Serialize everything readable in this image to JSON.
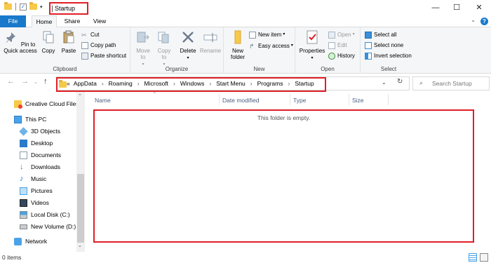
{
  "titlebar": {
    "title": "Startup",
    "minimize": "—",
    "maximize": "☐",
    "close": "✕"
  },
  "tabs": [
    {
      "label": "File"
    },
    {
      "label": "Home"
    },
    {
      "label": "Share"
    },
    {
      "label": "View"
    }
  ],
  "ribbon": {
    "clipboard": {
      "label": "Clipboard",
      "pin": "Pin to Quick access",
      "copy": "Copy",
      "paste": "Paste",
      "cut": "Cut",
      "copy_path": "Copy path",
      "paste_shortcut": "Paste shortcut"
    },
    "organize": {
      "label": "Organize",
      "move_to": "Move to",
      "copy_to": "Copy to",
      "delete": "Delete",
      "rename": "Rename"
    },
    "new": {
      "label": "New",
      "new_folder": "New folder",
      "new_item": "New item",
      "easy_access": "Easy access"
    },
    "open": {
      "label": "Open",
      "properties": "Properties",
      "open": "Open",
      "edit": "Edit",
      "history": "History"
    },
    "select": {
      "label": "Select",
      "select_all": "Select all",
      "select_none": "Select none",
      "invert": "Invert selection"
    }
  },
  "address": {
    "overflow": "«",
    "crumbs": [
      "AppData",
      "Roaming",
      "Microsoft",
      "Windows",
      "Start Menu",
      "Programs",
      "Startup"
    ]
  },
  "search": {
    "placeholder": "Search Startup"
  },
  "nav": {
    "items": [
      {
        "label": "Creative Cloud Files",
        "icon": "creative-cloud-icon"
      },
      {
        "label": "This PC",
        "icon": "pc-icon"
      },
      {
        "label": "3D Objects",
        "icon": "cube-icon"
      },
      {
        "label": "Desktop",
        "icon": "desktop-icon"
      },
      {
        "label": "Documents",
        "icon": "document-icon"
      },
      {
        "label": "Downloads",
        "icon": "download-icon"
      },
      {
        "label": "Music",
        "icon": "music-icon"
      },
      {
        "label": "Pictures",
        "icon": "picture-icon"
      },
      {
        "label": "Videos",
        "icon": "video-icon"
      },
      {
        "label": "Local Disk (C:)",
        "icon": "drive-icon"
      },
      {
        "label": "New Volume (D:)",
        "icon": "drive-icon"
      },
      {
        "label": "Network",
        "icon": "network-icon"
      }
    ]
  },
  "columns": {
    "name": "Name",
    "date_modified": "Date modified",
    "type": "Type",
    "size": "Size"
  },
  "content": {
    "empty_message": "This folder is empty."
  },
  "status": {
    "item_count": "0 items"
  },
  "colors": {
    "accent": "#1979ca",
    "highlight": "#e01e26",
    "folder": "#f7c948"
  }
}
